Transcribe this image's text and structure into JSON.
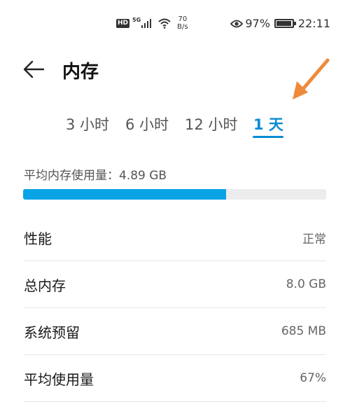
{
  "status_bar": {
    "hd": "HD",
    "network_type": "5G",
    "speed_value": "70",
    "speed_unit": "B/s",
    "battery": "97%",
    "battery_level": 0.97,
    "time": "22:11",
    "icons": [
      "hd-icon",
      "signal-icon",
      "wifi-icon",
      "eye-icon",
      "battery-icon"
    ]
  },
  "header": {
    "title": "内存",
    "back_icon": "arrow-left-icon"
  },
  "annotation": {
    "icon": "arrow-annotation-icon",
    "color": "#ef8a3a"
  },
  "tabs": {
    "items": [
      {
        "label": "3 小时",
        "selected": false
      },
      {
        "label": "6 小时",
        "selected": false
      },
      {
        "label": "12 小时",
        "selected": false
      },
      {
        "label": "1 天",
        "selected": true
      }
    ],
    "accent": "#0a8bd3"
  },
  "average": {
    "label": "平均内存使用量：4.89 GB",
    "usage_fraction": 0.67,
    "bar_color": "#0aa3e6"
  },
  "rows": [
    {
      "label": "性能",
      "value": "正常"
    },
    {
      "label": "总内存",
      "value": "8.0 GB"
    },
    {
      "label": "系统预留",
      "value": "685 MB"
    },
    {
      "label": "平均使用量",
      "value": "67%"
    }
  ]
}
